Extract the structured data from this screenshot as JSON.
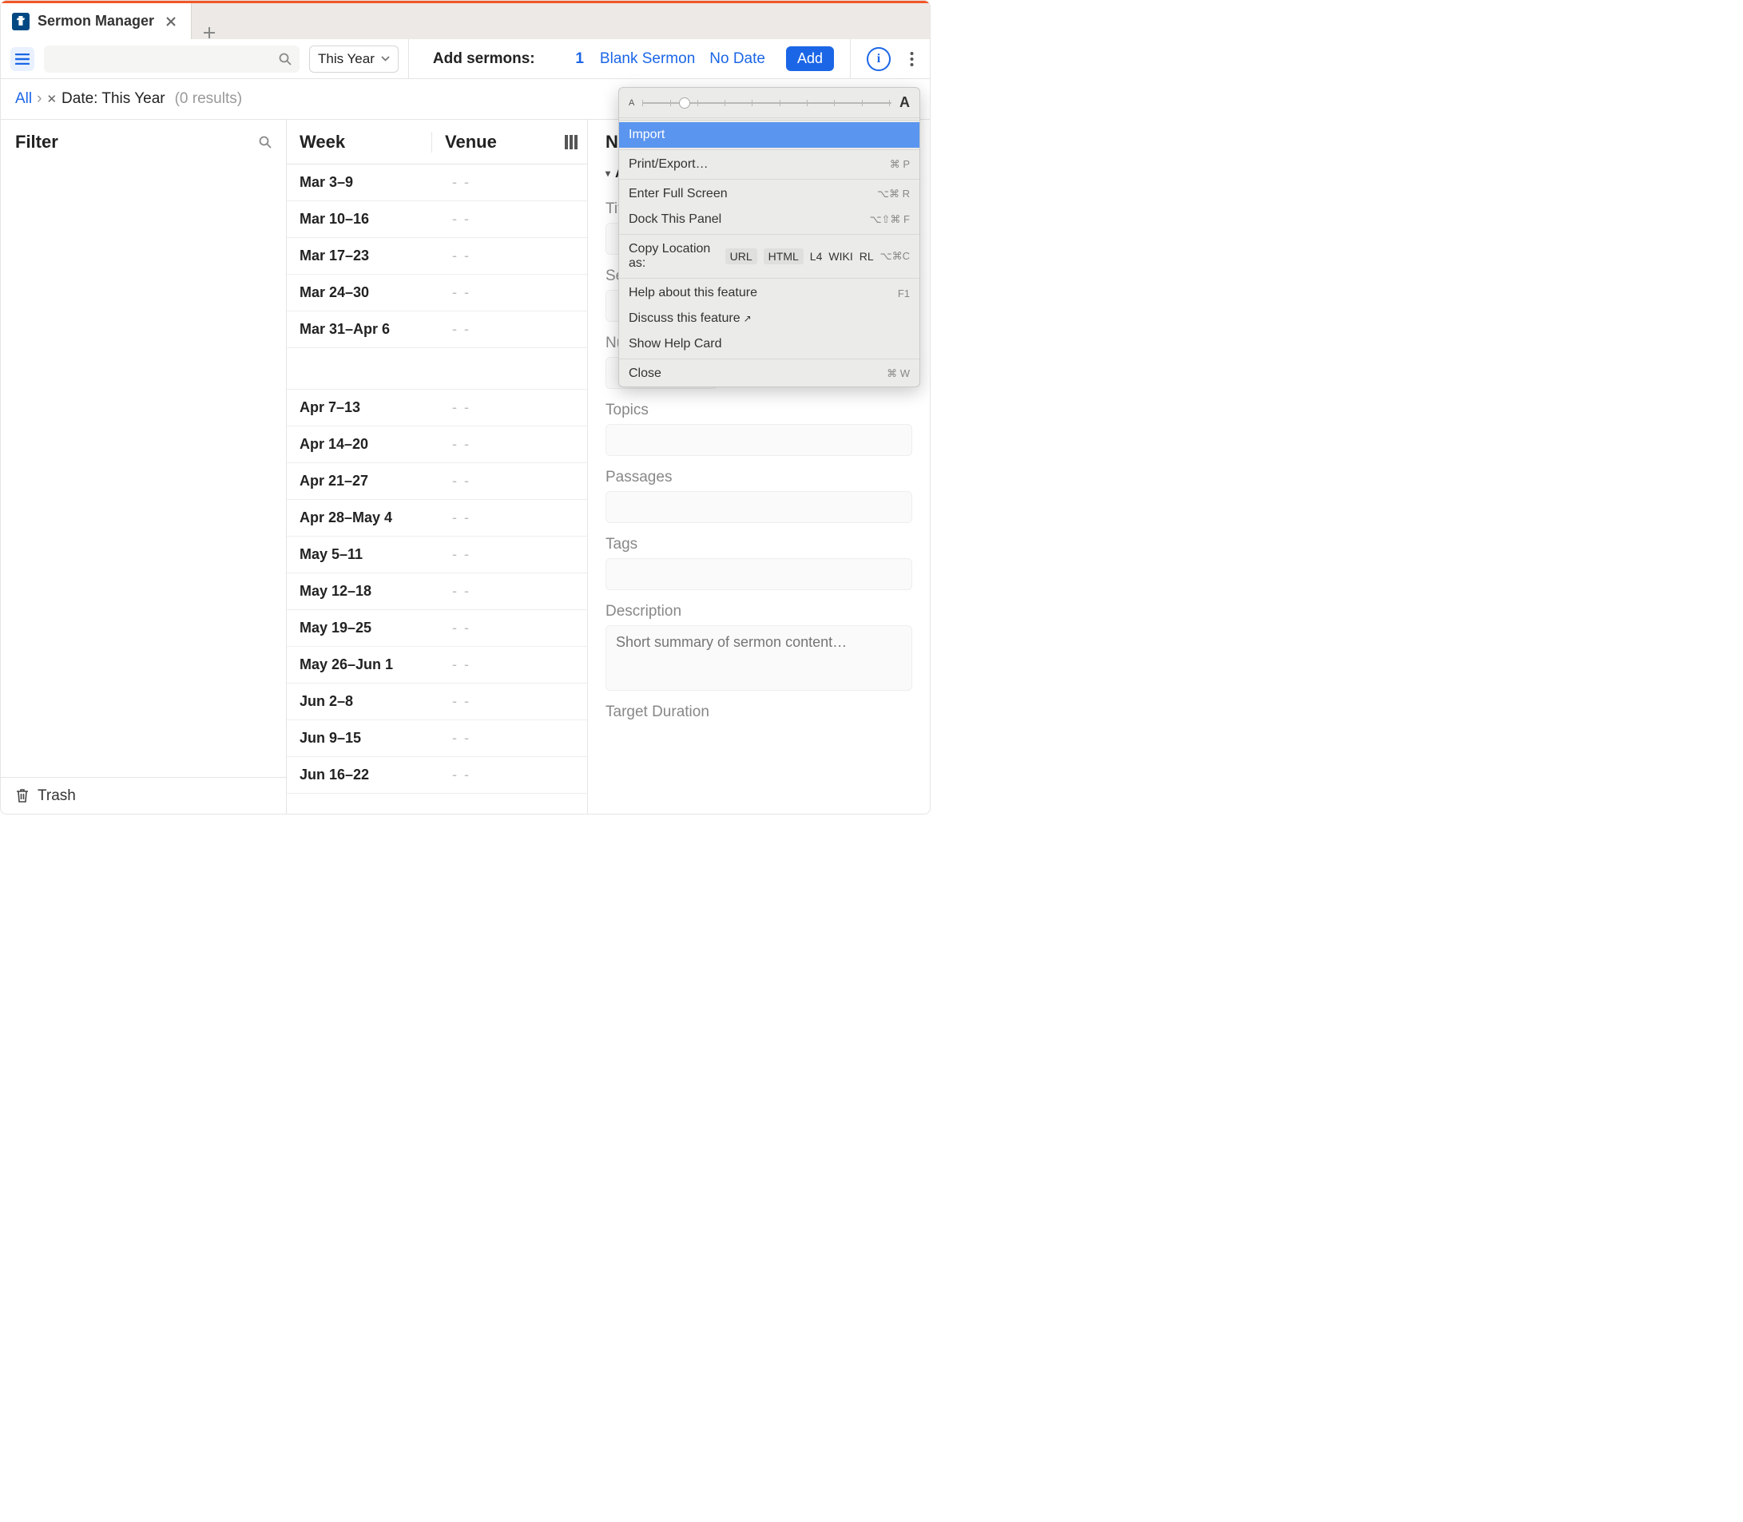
{
  "tab": {
    "title": "Sermon Manager"
  },
  "toolbar": {
    "filterDropdown": "This Year",
    "addLabel": "Add sermons:",
    "count": "1",
    "link1": "Blank Sermon",
    "link2": "No Date",
    "addButton": "Add"
  },
  "crumbs": {
    "all": "All",
    "dateLabel": "Date: This Year",
    "results": "(0 results)"
  },
  "filterCol": {
    "header": "Filter",
    "trash": "Trash"
  },
  "weekCol": {
    "weekHeader": "Week",
    "venueHeader": "Venue",
    "emptyVenue": "- -",
    "rows": [
      {
        "w": "Mar 3–9"
      },
      {
        "w": "Mar 10–16"
      },
      {
        "w": "Mar 17–23"
      },
      {
        "w": "Mar 24–30"
      },
      {
        "w": "Mar 31–Apr 6"
      },
      null,
      {
        "w": "Apr 7–13"
      },
      {
        "w": "Apr 14–20"
      },
      {
        "w": "Apr 21–27"
      },
      {
        "w": "Apr 28–May 4"
      },
      {
        "w": "May 5–11"
      },
      {
        "w": "May 12–18"
      },
      {
        "w": "May 19–25"
      },
      {
        "w": "May 26–Jun 1"
      },
      {
        "w": "Jun 2–8"
      },
      {
        "w": "Jun 9–15"
      },
      {
        "w": "Jun 16–22"
      }
    ]
  },
  "right": {
    "header": "No",
    "sectionAbout": "A",
    "titleLabel": "Tit",
    "seriesLabel": "Se",
    "numberLabel": "Number (in series)",
    "topicsLabel": "Topics",
    "passagesLabel": "Passages",
    "tagsLabel": "Tags",
    "descLabel": "Description",
    "descPlaceholder": "Short summary of sermon content…",
    "targetLabel": "Target Duration"
  },
  "popup": {
    "import": "Import",
    "printExport": "Print/Export…",
    "scPrint": "⌘ P",
    "fullscreen": "Enter Full Screen",
    "scFull": "⌥⌘ R",
    "dock": "Dock This Panel",
    "scDock": "⌥⇧⌘ F",
    "copyLoc": "Copy Location as:",
    "chipURL": "URL",
    "chipHTML": "HTML",
    "chipL4": "L4",
    "chipWIKI": "WIKI",
    "chipRL": "RL",
    "scCopy": "⌥⌘C",
    "help": "Help about this feature",
    "scHelp": "F1",
    "discuss": "Discuss this feature",
    "showHelp": "Show Help Card",
    "close": "Close",
    "scClose": "⌘ W"
  }
}
